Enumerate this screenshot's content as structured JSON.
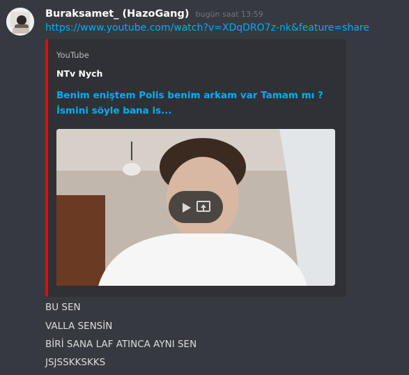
{
  "message": {
    "username": "Buraksamet_ (HazoGang)",
    "timestamp": "bugün saat 13:59",
    "link": "https://www.youtube.com/watch?v=XDqDRO7z-nk&feature=share",
    "embed": {
      "provider": "YouTube",
      "author": "NTv Nych",
      "title": "Benim eniştem Polis benim arkam var Tamam mı ? İsmini söyle bana is...",
      "video": {
        "play_icon": "play-icon",
        "open_icon": "external-link-icon"
      }
    },
    "lines": [
      "BU SEN",
      "VALLA SENSİN",
      "BİRİ SANA LAF ATINCA AYNI SEN",
      "JSJSSKKSKKS"
    ]
  },
  "colors": {
    "background": "#36393f",
    "embed_background": "#2f3136",
    "embed_accent": "#ff0000",
    "link": "#00b0f4"
  }
}
